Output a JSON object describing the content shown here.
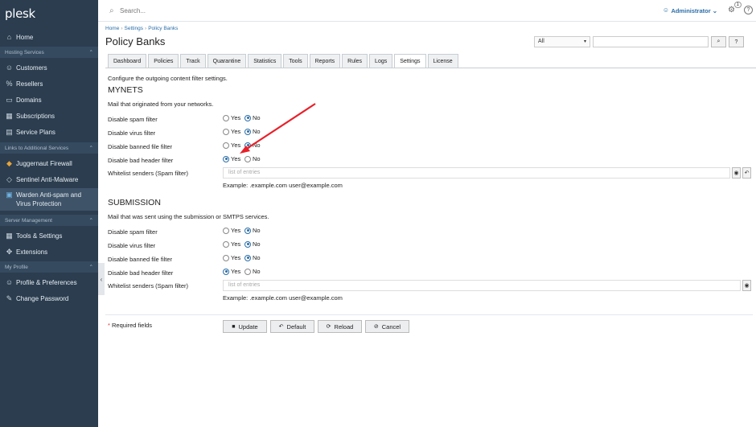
{
  "sidebar": {
    "logo": "plesk",
    "home": "Home",
    "sections": {
      "hosting": "Hosting Services",
      "links": "Links to Additional Services",
      "server": "Server Management",
      "profile": "My Profile"
    },
    "items": {
      "customers": "Customers",
      "resellers": "Resellers",
      "domains": "Domains",
      "subscriptions": "Subscriptions",
      "service_plans": "Service Plans",
      "juggernaut": "Juggernaut Firewall",
      "sentinel": "Sentinel Anti-Malware",
      "warden_line1": "Warden Anti-spam and",
      "warden_line2": "Virus Protection",
      "tools": "Tools & Settings",
      "extensions": "Extensions",
      "profile_prefs": "Profile & Preferences",
      "change_password": "Change Password"
    }
  },
  "topbar": {
    "search_placeholder": "Search...",
    "admin": "Administrator",
    "notif_count": "1"
  },
  "breadcrumb": [
    "Home",
    "Settings",
    "Policy Banks"
  ],
  "page_title": "Policy Banks",
  "filter": {
    "select_value": "All"
  },
  "tabs": [
    "Dashboard",
    "Policies",
    "Track",
    "Quarantine",
    "Statistics",
    "Tools",
    "Reports",
    "Rules",
    "Logs",
    "Settings",
    "License"
  ],
  "intro": "Configure the outgoing content filter settings.",
  "mynets": {
    "title": "MYNETS",
    "desc": "Mail that originated from your networks.",
    "rows": [
      {
        "label": "Disable spam filter",
        "value": "No"
      },
      {
        "label": "Disable virus filter",
        "value": "No"
      },
      {
        "label": "Disable banned file filter",
        "value": "No"
      },
      {
        "label": "Disable bad header filter",
        "value": "Yes"
      }
    ],
    "whitelist_label": "Whitelist senders (Spam filter)",
    "entries_placeholder": "list of entries",
    "example": "Example: .example.com user@example.com"
  },
  "submission": {
    "title": "SUBMISSION",
    "desc": "Mail that was sent using the submission or SMTPS services.",
    "rows": [
      {
        "label": "Disable spam filter",
        "value": "No"
      },
      {
        "label": "Disable virus filter",
        "value": "No"
      },
      {
        "label": "Disable banned file filter",
        "value": "No"
      },
      {
        "label": "Disable bad header filter",
        "value": "Yes"
      }
    ],
    "whitelist_label": "Whitelist senders (Spam filter)",
    "entries_placeholder": "list of entries",
    "example": "Example: .example.com user@example.com"
  },
  "radio_labels": {
    "yes": "Yes",
    "no": "No"
  },
  "footer": {
    "required": "Required fields",
    "update": "Update",
    "default": "Default",
    "reload": "Reload",
    "cancel": "Cancel"
  },
  "colors": {
    "sidebar": "#2b3d4f",
    "accent": "#2b6ea8",
    "arrow": "#e8202a"
  }
}
